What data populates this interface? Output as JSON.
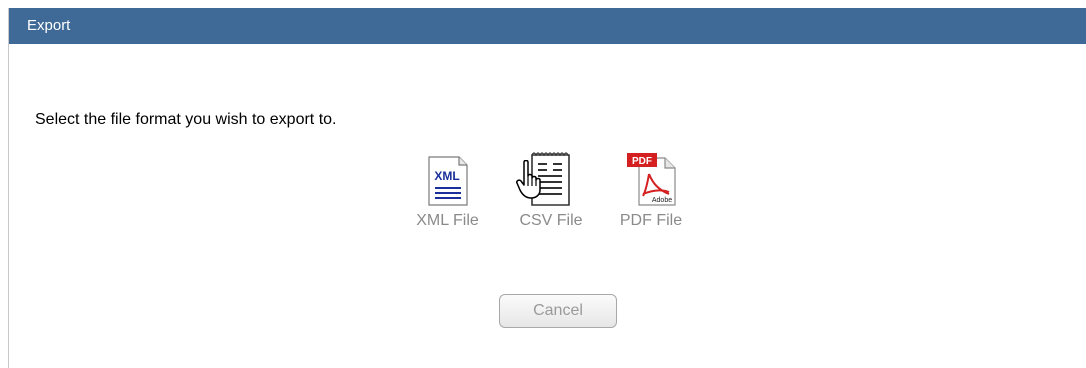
{
  "dialog": {
    "title": "Export",
    "prompt": "Select the file format you wish to export to.",
    "formats": [
      {
        "label": "XML File",
        "icon": "xml-file-icon",
        "icon_text": "XML"
      },
      {
        "label": "CSV File",
        "icon": "csv-file-icon"
      },
      {
        "label": "PDF File",
        "icon": "pdf-file-icon",
        "icon_text": "PDF",
        "brand_text": "Adobe"
      }
    ],
    "cancel_label": "Cancel"
  },
  "colors": {
    "titlebar": "#3f6a97",
    "xml_accent": "#1a2f9a",
    "pdf_red": "#d42020"
  }
}
